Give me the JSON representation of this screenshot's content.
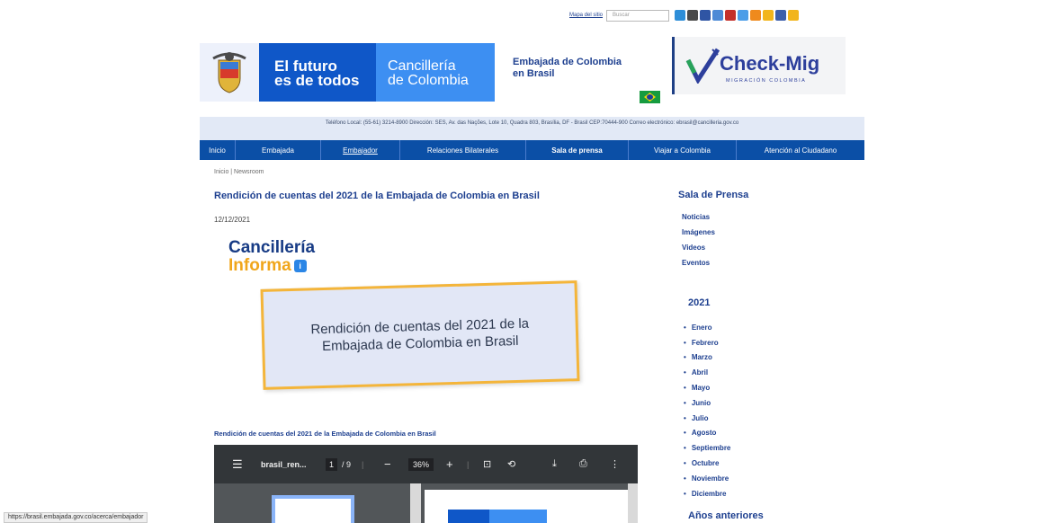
{
  "topbar": {
    "sitemap": "Mapa del sitio",
    "search_placeholder": "Buscar"
  },
  "header": {
    "logo_line1": "El futuro",
    "logo_line2": "es de todos",
    "canc_line1": "Cancillería",
    "canc_line2": "de Colombia",
    "embassy_line1": "Embajada de Colombia",
    "embassy_line2": "en Brasil",
    "checkmig_title": "Check-Mig",
    "checkmig_sub": "MIGRACIÓN COLOMBIA"
  },
  "contact": "Teléfono Local: (55-61) 3214-8900 Dirección: SES, Av. das Nações, Lote 10, Quadra 803, Brasília, DF - Brasil CEP:70444-900 Correo electrónico: ebrasil@cancilleria.gov.co",
  "nav": [
    {
      "label": "Inicio"
    },
    {
      "label": "Embajada"
    },
    {
      "label": "Embajador"
    },
    {
      "label": "Relaciones Bilaterales"
    },
    {
      "label": "Sala de prensa"
    },
    {
      "label": "Viajar a Colombia"
    },
    {
      "label": "Atención al Ciudadano"
    }
  ],
  "breadcrumb": "Inicio | Newsroom",
  "article": {
    "title": "Rendición de cuentas del 2021 de la Embajada de Colombia en Brasil",
    "date": "12/12/2021",
    "ci_line1": "Cancillería",
    "ci_line2": "Informa",
    "banner_text": "Rendición de cuentas del 2021 de la Embajada de Colombia en Brasil",
    "embed_title": "Rendición de cuentas del 2021 de la Embajada de Colombia en Brasil"
  },
  "pdf": {
    "filename": "brasil_ren...",
    "page_current": "1",
    "page_total": "/ 9",
    "zoom": "36%"
  },
  "sidebar": {
    "title": "Sala de Prensa",
    "links": [
      "Noticias",
      "Imágenes",
      "Videos",
      "Eventos"
    ],
    "year": "2021",
    "months": [
      "Enero",
      "Febrero",
      "Marzo",
      "Abril",
      "Mayo",
      "Junio",
      "Julio",
      "Agosto",
      "Septiembre",
      "Octubre",
      "Noviembre",
      "Diciembre"
    ],
    "older": "Años anteriores"
  },
  "status_url": "https://brasil.embajada.gov.co/acerca/embajador",
  "colors": {
    "primary_blue": "#0b4fa6",
    "title_blue": "#1d3f8f",
    "accent_orange": "#f4b53a"
  }
}
